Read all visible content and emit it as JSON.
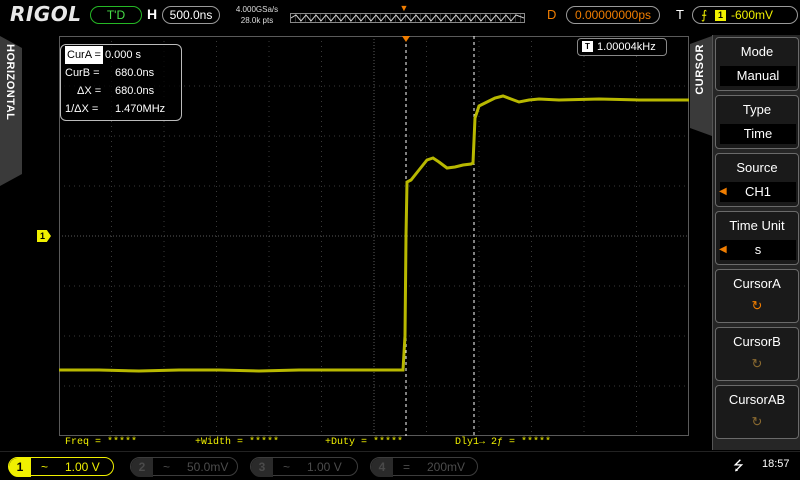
{
  "topbar": {
    "brand": "RIGOL",
    "trigger_status": "T'D",
    "h_label": "H",
    "timebase": "500.0ns",
    "sample_rate": "4.000GSa/s",
    "memory_depth": "28.0k pts",
    "d_label": "D",
    "h_position": "0.00000000ps",
    "t_label": "T",
    "trigger_edge_icon": "rising-edge-icon",
    "trigger_source": "1",
    "trigger_level": "-600mV"
  },
  "left_tab": {
    "label": "HORIZONTAL"
  },
  "cursor_readout": {
    "cur_a_label": "CurA =",
    "cur_a_value": "0.000 s",
    "cur_b_label": "CurB =",
    "cur_b_value": "680.0ns",
    "dx_label": "ΔX =",
    "dx_value": "680.0ns",
    "inv_dx_label": "1/ΔX =",
    "inv_dx_value": "1.470MHz"
  },
  "freq_counter": {
    "chip": "T",
    "value": "1.00004kHz"
  },
  "channel_marker": {
    "label": "1"
  },
  "measurements": {
    "freq": "Freq = *****",
    "width": "+Width = *****",
    "duty": "+Duty = *****",
    "delay": "Dly1→ 2ƒ  = *****"
  },
  "menu": {
    "title": "CURSOR",
    "buttons": [
      {
        "label": "Mode",
        "value": "Manual"
      },
      {
        "label": "Type",
        "value": "Time"
      },
      {
        "label": "Source",
        "value": "CH1"
      },
      {
        "label": "Time Unit",
        "value": "s"
      },
      {
        "label": "CursorA",
        "knob": "↻"
      },
      {
        "label": "CursorB",
        "knob": "↻"
      },
      {
        "label": "CursorAB",
        "knob": "↻"
      }
    ]
  },
  "channels": [
    {
      "num": "1",
      "coupling": "~",
      "scale": "1.00 V",
      "active": true
    },
    {
      "num": "2",
      "coupling": "~",
      "scale": "50.0mV",
      "active": false
    },
    {
      "num": "3",
      "coupling": "~",
      "scale": "1.00 V",
      "active": false
    },
    {
      "num": "4",
      "coupling": "=",
      "scale": "200mV",
      "active": false
    }
  ],
  "statusbar": {
    "usb_icon": "usb-icon",
    "time": "18:57"
  },
  "colors": {
    "ch1": "#f0f000",
    "accent": "#f07d00",
    "trigger_ok": "#47e047",
    "grid": "#3a3a3a"
  }
}
